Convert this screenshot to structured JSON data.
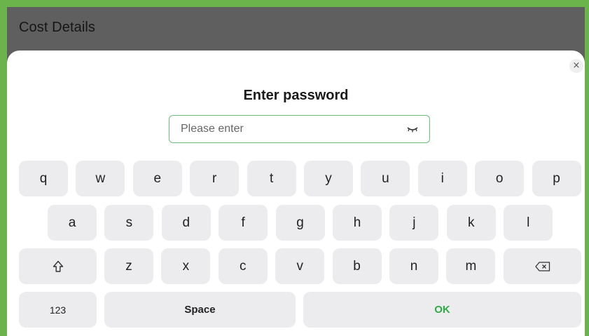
{
  "header": {
    "title": "Cost Details"
  },
  "dialog": {
    "close_glyph": "×",
    "title": "Enter password",
    "password": {
      "value": "",
      "placeholder": "Please enter",
      "visibility_icon": "eye-closed-icon"
    }
  },
  "keyboard": {
    "row1": [
      "q",
      "w",
      "e",
      "r",
      "t",
      "y",
      "u",
      "i",
      "o",
      "p"
    ],
    "row2": [
      "a",
      "s",
      "d",
      "f",
      "g",
      "h",
      "j",
      "k",
      "l"
    ],
    "row3": [
      "z",
      "x",
      "c",
      "v",
      "b",
      "n",
      "m"
    ],
    "shift_icon": "shift-icon",
    "backspace_icon": "backspace-icon",
    "numbers_label": "123",
    "space_label": "Space",
    "ok_label": "OK"
  },
  "colors": {
    "frame_border": "#6bb44b",
    "header_bg": "#5f5f5f",
    "field_border": "#6bc07b",
    "ok_text": "#2eab45",
    "key_bg": "#ececef"
  }
}
